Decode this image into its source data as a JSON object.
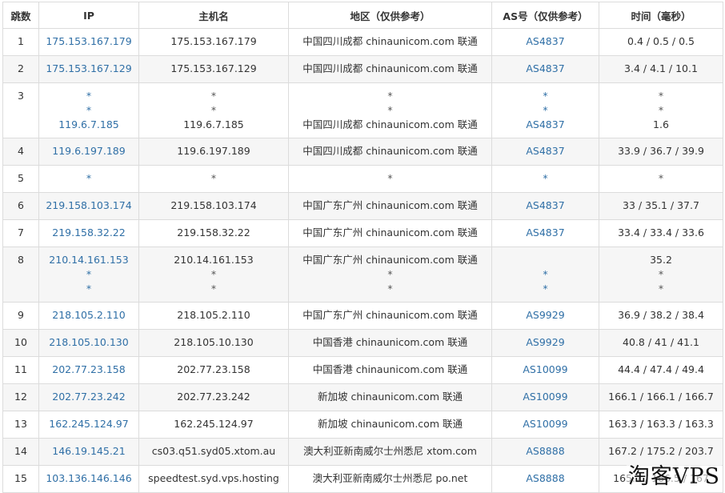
{
  "table": {
    "headers": [
      "跳数",
      "IP",
      "主机名",
      "地区（仅供参考）",
      "AS号（仅供参考）",
      "时间（毫秒）"
    ],
    "rows": [
      {
        "hop": "1",
        "ip": [
          "175.153.167.179"
        ],
        "host": [
          "175.153.167.179"
        ],
        "region": [
          "中国四川成都 chinaunicom.com 联通"
        ],
        "as": [
          "AS4837"
        ],
        "time": [
          "0.4 / 0.5 / 0.5"
        ]
      },
      {
        "hop": "2",
        "ip": [
          "175.153.167.129"
        ],
        "host": [
          "175.153.167.129"
        ],
        "region": [
          "中国四川成都 chinaunicom.com 联通"
        ],
        "as": [
          "AS4837"
        ],
        "time": [
          "3.4 / 4.1 / 10.1"
        ]
      },
      {
        "hop": "3",
        "ip": [
          "*",
          "*",
          "119.6.7.185"
        ],
        "host": [
          "*",
          "*",
          "119.6.7.185"
        ],
        "region": [
          "*",
          "*",
          "中国四川成都 chinaunicom.com 联通"
        ],
        "as": [
          "*",
          "*",
          "AS4837"
        ],
        "time": [
          "*",
          "*",
          "1.6"
        ]
      },
      {
        "hop": "4",
        "ip": [
          "119.6.197.189"
        ],
        "host": [
          "119.6.197.189"
        ],
        "region": [
          "中国四川成都 chinaunicom.com 联通"
        ],
        "as": [
          "AS4837"
        ],
        "time": [
          "33.9 / 36.7 / 39.9"
        ]
      },
      {
        "hop": "5",
        "ip": [
          "*"
        ],
        "host": [
          "*"
        ],
        "region": [
          "*"
        ],
        "as": [
          "*"
        ],
        "time": [
          "*"
        ]
      },
      {
        "hop": "6",
        "ip": [
          "219.158.103.174"
        ],
        "host": [
          "219.158.103.174"
        ],
        "region": [
          "中国广东广州 chinaunicom.com 联通"
        ],
        "as": [
          "AS4837"
        ],
        "time": [
          "33 / 35.1 / 37.7"
        ]
      },
      {
        "hop": "7",
        "ip": [
          "219.158.32.22"
        ],
        "host": [
          "219.158.32.22"
        ],
        "region": [
          "中国广东广州 chinaunicom.com 联通"
        ],
        "as": [
          "AS4837"
        ],
        "time": [
          "33.4 / 33.4 / 33.6"
        ]
      },
      {
        "hop": "8",
        "ip": [
          "210.14.161.153",
          "*",
          "*"
        ],
        "host": [
          "210.14.161.153",
          "*",
          "*"
        ],
        "region": [
          "中国广东广州 chinaunicom.com 联通",
          "*",
          "*"
        ],
        "as": [
          "",
          "*",
          "*"
        ],
        "time": [
          "35.2",
          "*",
          "*"
        ]
      },
      {
        "hop": "9",
        "ip": [
          "218.105.2.110"
        ],
        "host": [
          "218.105.2.110"
        ],
        "region": [
          "中国广东广州 chinaunicom.com 联通"
        ],
        "as": [
          "AS9929"
        ],
        "time": [
          "36.9 / 38.2 / 38.4"
        ]
      },
      {
        "hop": "10",
        "ip": [
          "218.105.10.130"
        ],
        "host": [
          "218.105.10.130"
        ],
        "region": [
          "中国香港 chinaunicom.com 联通"
        ],
        "as": [
          "AS9929"
        ],
        "time": [
          "40.8 / 41 / 41.1"
        ]
      },
      {
        "hop": "11",
        "ip": [
          "202.77.23.158"
        ],
        "host": [
          "202.77.23.158"
        ],
        "region": [
          "中国香港 chinaunicom.com 联通"
        ],
        "as": [
          "AS10099"
        ],
        "time": [
          "44.4 / 47.4 / 49.4"
        ]
      },
      {
        "hop": "12",
        "ip": [
          "202.77.23.242"
        ],
        "host": [
          "202.77.23.242"
        ],
        "region": [
          "新加坡 chinaunicom.com 联通"
        ],
        "as": [
          "AS10099"
        ],
        "time": [
          "166.1 / 166.1 / 166.7"
        ]
      },
      {
        "hop": "13",
        "ip": [
          "162.245.124.97"
        ],
        "host": [
          "162.245.124.97"
        ],
        "region": [
          "新加坡 chinaunicom.com 联通"
        ],
        "as": [
          "AS10099"
        ],
        "time": [
          "163.3 / 163.3 / 163.3"
        ]
      },
      {
        "hop": "14",
        "ip": [
          "146.19.145.21"
        ],
        "host": [
          "cs03.q51.syd05.xtom.au"
        ],
        "region": [
          "澳大利亚新南威尔士州悉尼 xtom.com"
        ],
        "as": [
          "AS8888"
        ],
        "time": [
          "167.2 / 175.2 / 203.7"
        ]
      },
      {
        "hop": "15",
        "ip": [
          "103.136.146.146"
        ],
        "host": [
          "speedtest.syd.vps.hosting"
        ],
        "region": [
          "澳大利亚新南威尔士州悉尼 po.net"
        ],
        "as": [
          "AS8888"
        ],
        "time": [
          "165.7 / 166.5 / 167"
        ]
      }
    ]
  },
  "watermark": "淘客VPS",
  "colors": {
    "link": "#2f6fa6",
    "border": "#dcdcdc",
    "stripe": "#f6f6f6"
  }
}
